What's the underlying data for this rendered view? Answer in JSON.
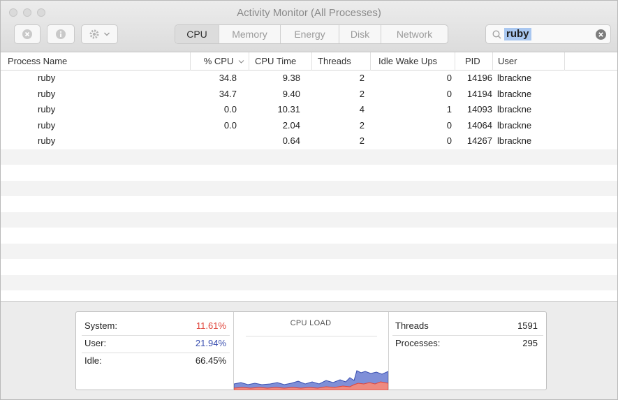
{
  "window": {
    "title": "Activity Monitor (All Processes)"
  },
  "toolbar": {
    "tabs": [
      {
        "label": "CPU",
        "active": true
      },
      {
        "label": "Memory",
        "active": false
      },
      {
        "label": "Energy",
        "active": false
      },
      {
        "label": "Disk",
        "active": false
      },
      {
        "label": "Network",
        "active": false
      }
    ],
    "search": {
      "value": "ruby"
    },
    "icons": [
      "stop-process-icon",
      "info-icon",
      "gear-icon",
      "chevron-down-icon",
      "search-icon",
      "clear-icon"
    ]
  },
  "table": {
    "columns": [
      "Process Name",
      "% CPU",
      "CPU Time",
      "Threads",
      "Idle Wake Ups",
      "PID",
      "User"
    ],
    "sort": {
      "column": "% CPU",
      "direction": "descending"
    },
    "rows": [
      {
        "name": "ruby",
        "cpu": "34.8",
        "cpu_time": "9.38",
        "threads": "2",
        "idle_wake_ups": "0",
        "pid": "14196",
        "user": "lbrackne"
      },
      {
        "name": "ruby",
        "cpu": "34.7",
        "cpu_time": "9.40",
        "threads": "2",
        "idle_wake_ups": "0",
        "pid": "14194",
        "user": "lbrackne"
      },
      {
        "name": "ruby",
        "cpu": "0.0",
        "cpu_time": "10.31",
        "threads": "4",
        "idle_wake_ups": "1",
        "pid": "14093",
        "user": "lbrackne"
      },
      {
        "name": "ruby",
        "cpu": "0.0",
        "cpu_time": "2.04",
        "threads": "2",
        "idle_wake_ups": "0",
        "pid": "14064",
        "user": "lbrackne"
      },
      {
        "name": "ruby",
        "cpu": "",
        "cpu_time": "0.64",
        "threads": "2",
        "idle_wake_ups": "0",
        "pid": "14267",
        "user": "lbrackne"
      }
    ]
  },
  "summary": {
    "system_label": "System:",
    "system_value": "11.61%",
    "user_label": "User:",
    "user_value": "21.94%",
    "idle_label": "Idle:",
    "idle_value": "66.45%",
    "cpu_load_title": "CPU LOAD",
    "threads_label": "Threads",
    "threads_value": "1591",
    "processes_label": "Processes:",
    "processes_value": "295"
  },
  "colors": {
    "system": "#e0443a",
    "user": "#3a4fb0",
    "search_highlight": "#a9c7f0"
  }
}
